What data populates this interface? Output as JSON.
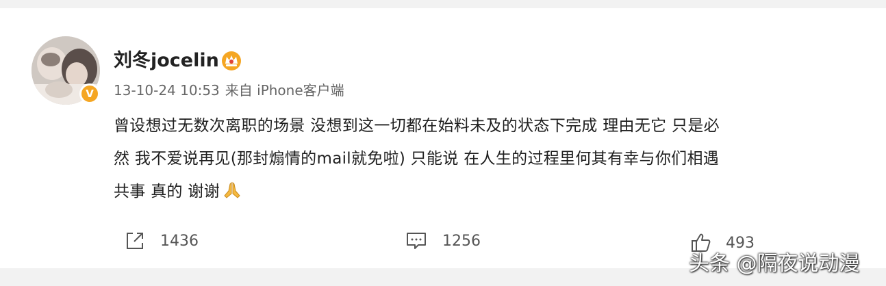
{
  "post": {
    "username": "刘冬jocelin",
    "timestamp": "13-10-24 10:53",
    "source": "来自 iPhone客户端",
    "content_lines": [
      "曾设想过无数次离职的场景 没想到这一切都在始料未及的状态下完成 理由无它 只是必",
      "然 我不爱说再见(那封煽情的mail就免啦) 只能说 在人生的过程里何其有幸与你们相遇",
      "共事 真的 谢谢"
    ],
    "badge_letter": "V"
  },
  "actions": {
    "repost_count": "1436",
    "comment_count": "1256",
    "like_count": "493"
  },
  "watermark": "头条 @隔夜说动漫",
  "colors": {
    "verified_badge": "#f5a623",
    "crown": "#f5a623",
    "text": "#1f1f1f",
    "meta": "#666666"
  }
}
